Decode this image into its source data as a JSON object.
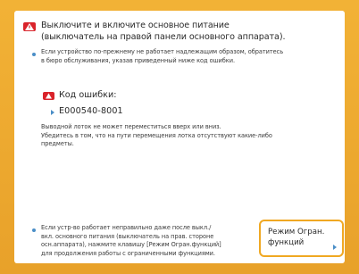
{
  "dialog": {
    "headline": "Выключите и включите основное питание\n(выключатель на правой панели основного аппарата).",
    "note_top": "Если устройство по-прежнему не работает надлежащим образом, обратитесь\nв бюро обслуживания, указав приведенный ниже код ошибки.",
    "error_code_label": "Код ошибки:",
    "error_code_value": "E000540-8001",
    "description": "Выводной лоток не может переместиться вверх или вниз.\nУбедитесь в том, что на пути перемещения лотка отсутствуют какие-либо\nпредметы.",
    "note_bottom": "Если устр-во работает неправильно даже после выкл./\nвкл. основного питания (выключатель на прав. стороне\nосн.аппарата), нажмите клавишу [Режим Огран.функций]\nдля продолжения работы с ограниченными функциями.",
    "action_button_label": "Режим Огран.\nфункций"
  },
  "icons": {
    "warning": "warning-icon",
    "error_code": "error-code-icon",
    "arrow": "arrow-right-icon"
  },
  "colors": {
    "frame": "#e8a12a",
    "warning_red": "#d9232b",
    "accent_blue": "#4a8ec7",
    "button_border": "#f0a822"
  }
}
